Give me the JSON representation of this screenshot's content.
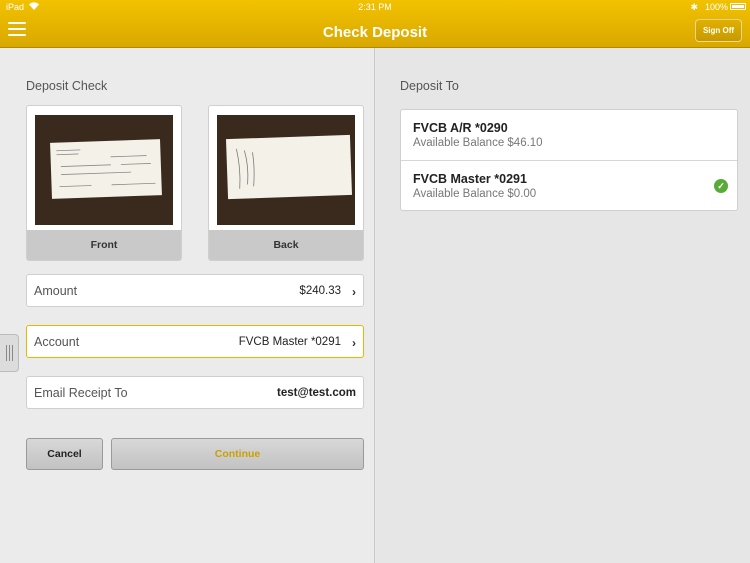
{
  "status_bar": {
    "carrier": "iPad",
    "time": "2:31 PM",
    "battery": "100%"
  },
  "header": {
    "title": "Check Deposit",
    "sign_off": "Sign Off"
  },
  "deposit_check": {
    "label": "Deposit Check",
    "front_label": "Front",
    "back_label": "Back",
    "amount": {
      "label": "Amount",
      "value": "$240.33"
    },
    "account": {
      "label": "Account",
      "value": "FVCB Master *0291"
    },
    "email": {
      "label": "Email Receipt To",
      "value": "test@test.com"
    },
    "cancel": "Cancel",
    "continue": "Continue"
  },
  "deposit_to": {
    "label": "Deposit To",
    "accounts": [
      {
        "name": "FVCB A/R *0290",
        "balance": "Available Balance $46.10",
        "selected": false
      },
      {
        "name": "FVCB Master *0291",
        "balance": "Available Balance $0.00",
        "selected": true
      }
    ]
  },
  "colors": {
    "header": "#f2c200",
    "accent": "#c9a100",
    "selected_check": "#5aaa3a"
  }
}
